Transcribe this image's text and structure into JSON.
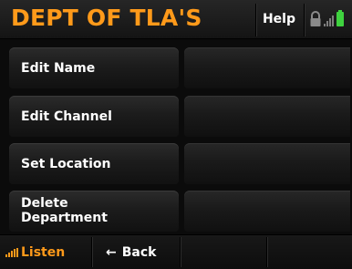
{
  "header": {
    "title": "DEPT OF TLA'S",
    "help_label": "Help"
  },
  "menu": {
    "items": [
      {
        "label": "Edit Name",
        "value": ""
      },
      {
        "label": "Edit Channel",
        "value": ""
      },
      {
        "label": "Set Location",
        "value": ""
      },
      {
        "label": "Delete Department",
        "value": ""
      }
    ]
  },
  "footer": {
    "listen_label": "Listen",
    "back_label": "Back",
    "back_arrow": "←"
  },
  "icons": {
    "lock": "lock-icon",
    "signal": "signal-icon",
    "battery": "battery-icon",
    "listen_signal": "signal-icon"
  },
  "colors": {
    "accent": "#ff9a1a",
    "battery": "#3fd23f",
    "background": "#0b0b0b"
  }
}
